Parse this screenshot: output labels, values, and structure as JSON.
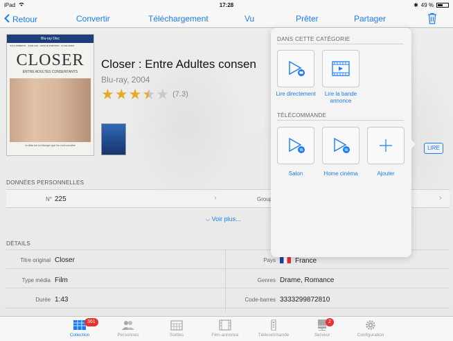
{
  "status_bar": {
    "device": "iPad",
    "time": "17:28",
    "battery": "49 %"
  },
  "nav": {
    "back_label": "Retour",
    "convert_label": "Convertir",
    "download_label": "Téléchargement",
    "seen_label": "Vu",
    "lend_label": "Prêter",
    "share_label": "Partager",
    "trash_icon": "trash-icon"
  },
  "movie": {
    "cover_brand": "Blu-ray Disc",
    "cover_names": "JULIA ROBERTS · JUDE LAW · NATALIE PORTMAN · CLIVE OWEN",
    "cover_title": "CLOSER",
    "cover_subtitle": "ENTRE ADULTES CONSENTANTS",
    "cover_tagline": "Le désir est un étranger que l'on croit connaître",
    "title": "Closer : Entre Adultes consen",
    "subtitle": "Blu-ray, 2004",
    "rating_stars": 3.5,
    "rating_text": "(7.3)",
    "star_colors": {
      "full": "#e6a92a",
      "empty": "#c8c8c8"
    }
  },
  "personal": {
    "header": "DONNÉES PERSONNELLES",
    "number_label": "N°",
    "number_value": "225",
    "group_label": "Group",
    "see_more": "Voir plus..."
  },
  "details": {
    "header": "DÉTAILS",
    "original_title_label": "Titre original",
    "original_title_value": "Closer",
    "media_type_label": "Type média",
    "media_type_value": "Film",
    "duration_label": "Durée",
    "duration_value": "1:43",
    "country_label": "Pays",
    "country_value": "France",
    "genres_label": "Genres",
    "genres_value": "Drame, Romance",
    "barcode_label": "Code-barres",
    "barcode_value": "3333299872810"
  },
  "play_button": {
    "label": "LIRE"
  },
  "popover": {
    "category_header": "DANS CETTE CATÉGORIE",
    "play_direct_label": "Lire directement",
    "play_trailer_label": "Lire la bande annonce",
    "remote_header": "TÉLÉCOMMANDE",
    "salon_label": "Salon",
    "home_cinema_label": "Home cinéma",
    "add_label": "Ajouter"
  },
  "tabs": [
    {
      "label": "Collection",
      "icon": "collection-icon",
      "active": true,
      "badge": "361"
    },
    {
      "label": "Personnes",
      "icon": "people-icon",
      "active": false
    },
    {
      "label": "Sorties",
      "icon": "calendar-icon",
      "active": false
    },
    {
      "label": "Film-annonce",
      "icon": "film-icon",
      "active": false
    },
    {
      "label": "Télécommande",
      "icon": "remote-icon",
      "active": false
    },
    {
      "label": "Serveur",
      "icon": "server-icon",
      "active": false,
      "badge": "2"
    },
    {
      "label": "Configuration",
      "icon": "gear-icon",
      "active": false
    }
  ],
  "colors": {
    "accent": "#1a7cf5",
    "badge": "#e5322d"
  }
}
